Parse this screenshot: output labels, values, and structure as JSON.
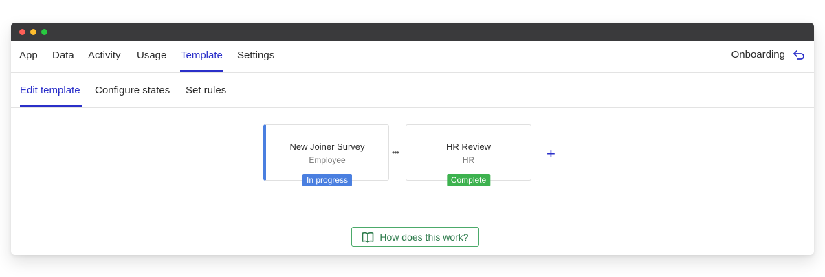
{
  "topnav": {
    "tabs": [
      {
        "label": "App"
      },
      {
        "label": "Data"
      },
      {
        "label": "Activity"
      },
      {
        "label": "Usage"
      },
      {
        "label": "Template"
      },
      {
        "label": "Settings"
      }
    ],
    "active_tab": "Template",
    "onboarding_label": "Onboarding",
    "back_icon": "return-arrow-icon"
  },
  "subnav": {
    "tabs": [
      {
        "label": "Edit template"
      },
      {
        "label": "Configure states"
      },
      {
        "label": "Set rules"
      }
    ],
    "active_tab": "Edit template"
  },
  "workflow": {
    "steps": [
      {
        "name": "New Joiner Survey",
        "role": "Employee",
        "status": "In progress",
        "status_color": "#4a7fe0"
      },
      {
        "name": "HR Review",
        "role": "HR",
        "status": "Complete",
        "status_color": "#3db24f"
      }
    ],
    "connector_label": "•••",
    "add_label": "+"
  },
  "help": {
    "label": "How does this work?",
    "icon": "book-icon"
  },
  "colors": {
    "accent": "#2a2fc9",
    "titlebar": "#3a3a3c",
    "help_green": "#2c7a4a"
  }
}
